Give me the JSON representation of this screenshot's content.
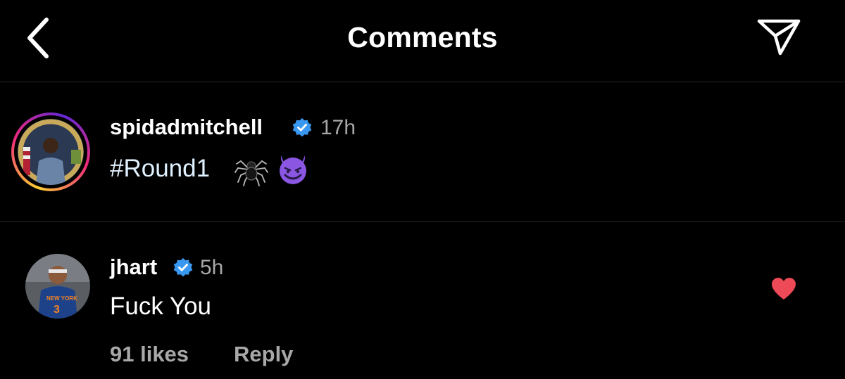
{
  "header": {
    "title": "Comments",
    "back_icon": "chevron-left-icon",
    "send_icon": "paper-plane-icon"
  },
  "caption": {
    "username": "spidadmitchell",
    "verified": true,
    "time": "17h",
    "hashtag": "#Round1",
    "emojis": [
      "spider",
      "smiling-face-with-horns"
    ],
    "ring_colors": [
      "#f9ce34",
      "#ee2a7b",
      "#6228d7"
    ]
  },
  "comment": {
    "username": "jhart",
    "verified": true,
    "time": "5h",
    "text": "Fuck You",
    "likes": "91 likes",
    "reply_label": "Reply",
    "liked": true
  },
  "colors": {
    "background": "#000000",
    "text": "#ffffff",
    "muted": "#a8a8a8",
    "verified_blue": "#3897f0",
    "like_red": "#ed4956"
  }
}
